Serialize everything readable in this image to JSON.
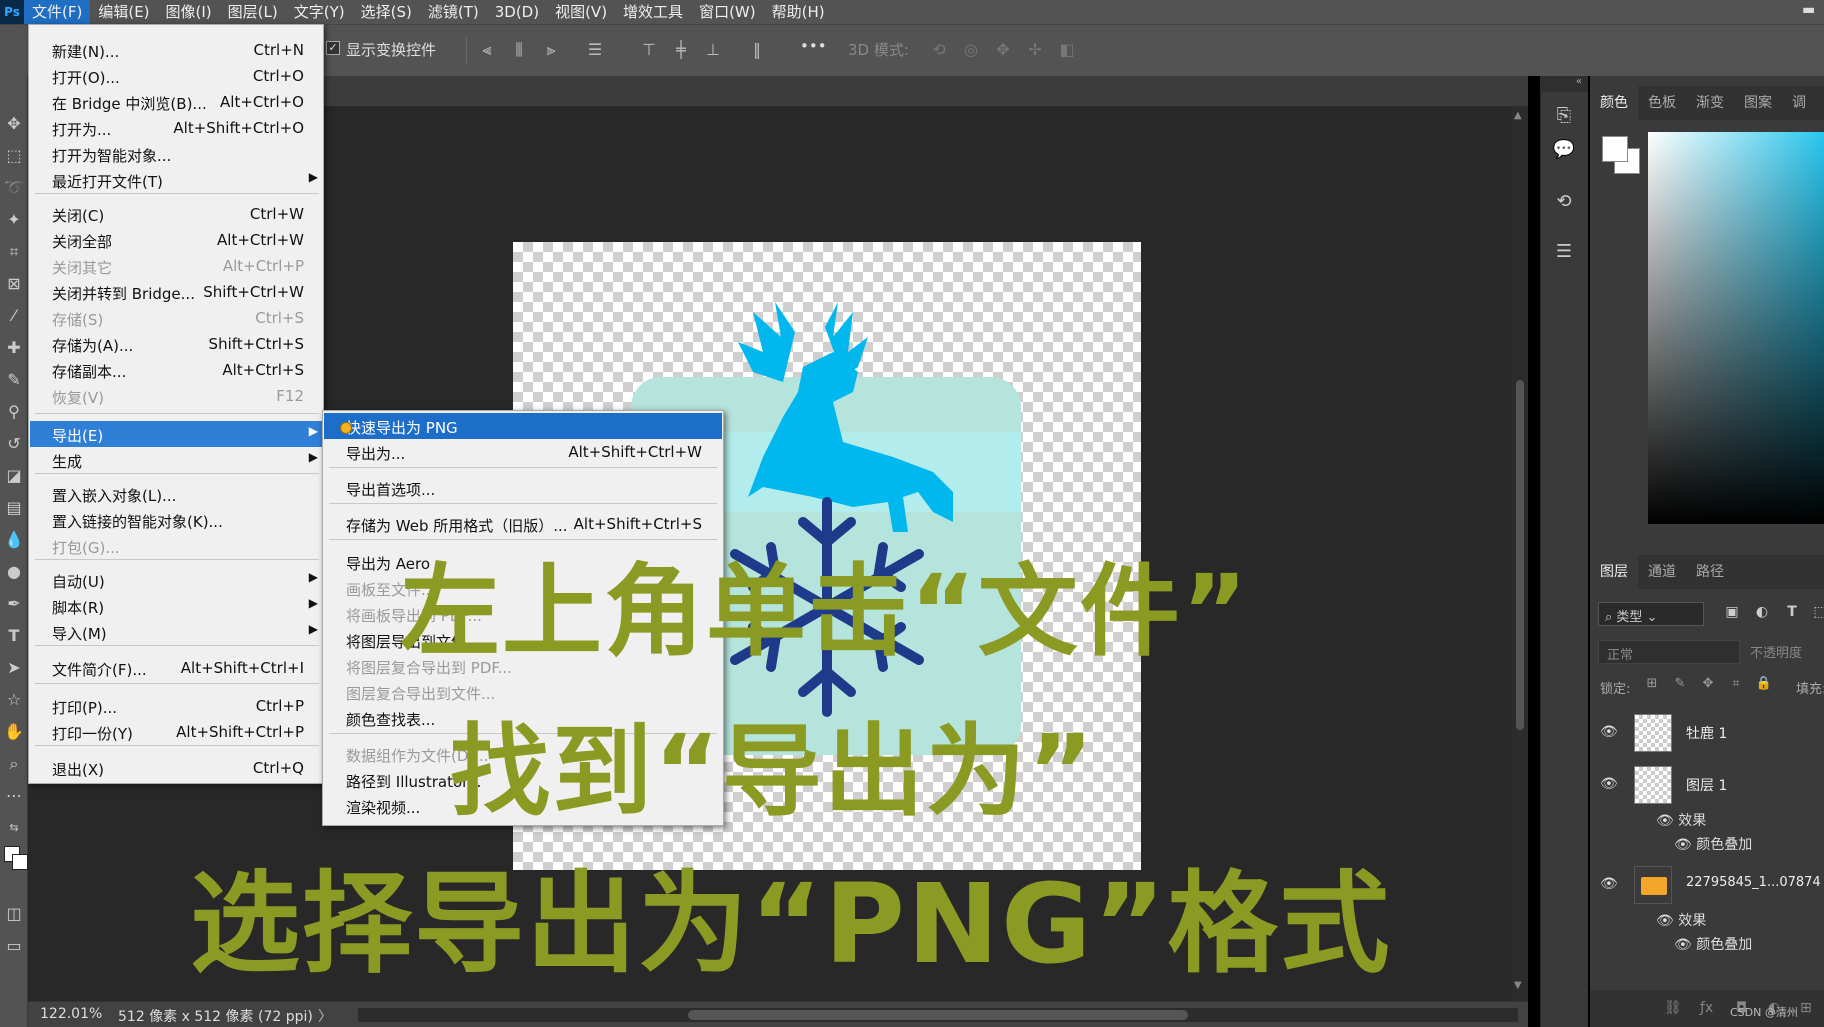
{
  "menubar": {
    "logo": "Ps",
    "items": [
      "文件(F)",
      "编辑(E)",
      "图像(I)",
      "图层(L)",
      "文字(Y)",
      "选择(S)",
      "滤镜(T)",
      "3D(D)",
      "视图(V)",
      "增效工具",
      "窗口(W)",
      "帮助(H)"
    ],
    "minimize": "▬"
  },
  "options": {
    "show_transform": "显示变换控件",
    "more": "•••",
    "mode3d": "3D 模式:"
  },
  "file_menu": {
    "items": [
      {
        "label": "新建(N)...",
        "shortcut": "Ctrl+N"
      },
      {
        "label": "打开(O)...",
        "shortcut": "Ctrl+O"
      },
      {
        "label": "在 Bridge 中浏览(B)...",
        "shortcut": "Alt+Ctrl+O"
      },
      {
        "label": "打开为...",
        "shortcut": "Alt+Shift+Ctrl+O"
      },
      {
        "label": "打开为智能对象...",
        "shortcut": ""
      },
      {
        "label": "最近打开文件(T)",
        "shortcut": ""
      },
      {
        "label": "关闭(C)",
        "shortcut": "Ctrl+W"
      },
      {
        "label": "关闭全部",
        "shortcut": "Alt+Ctrl+W"
      },
      {
        "label": "关闭其它",
        "shortcut": "Alt+Ctrl+P"
      },
      {
        "label": "关闭并转到 Bridge...",
        "shortcut": "Shift+Ctrl+W"
      },
      {
        "label": "存储(S)",
        "shortcut": "Ctrl+S"
      },
      {
        "label": "存储为(A)...",
        "shortcut": "Shift+Ctrl+S"
      },
      {
        "label": "存储副本...",
        "shortcut": "Alt+Ctrl+S"
      },
      {
        "label": "恢复(V)",
        "shortcut": "F12"
      },
      {
        "label": "导出(E)",
        "shortcut": ""
      },
      {
        "label": "生成",
        "shortcut": ""
      },
      {
        "label": "置入嵌入对象(L)...",
        "shortcut": ""
      },
      {
        "label": "置入链接的智能对象(K)...",
        "shortcut": ""
      },
      {
        "label": "打包(G)...",
        "shortcut": ""
      },
      {
        "label": "自动(U)",
        "shortcut": ""
      },
      {
        "label": "脚本(R)",
        "shortcut": ""
      },
      {
        "label": "导入(M)",
        "shortcut": ""
      },
      {
        "label": "文件简介(F)...",
        "shortcut": "Alt+Shift+Ctrl+I"
      },
      {
        "label": "打印(P)...",
        "shortcut": "Ctrl+P"
      },
      {
        "label": "打印一份(Y)",
        "shortcut": "Alt+Shift+Ctrl+P"
      },
      {
        "label": "退出(X)",
        "shortcut": "Ctrl+Q"
      }
    ],
    "arrow": "▶"
  },
  "export_menu": {
    "items": [
      {
        "label": "快速导出为 PNG",
        "shortcut": ""
      },
      {
        "label": "导出为...",
        "shortcut": "Alt+Shift+Ctrl+W"
      },
      {
        "label": "导出首选项...",
        "shortcut": ""
      },
      {
        "label": "存储为 Web 所用格式（旧版）...",
        "shortcut": "Alt+Shift+Ctrl+S"
      },
      {
        "label": "导出为 Aero",
        "shortcut": ""
      },
      {
        "label": "画板至文件...",
        "shortcut": ""
      },
      {
        "label": "将画板导出到 PDF...",
        "shortcut": ""
      },
      {
        "label": "将图层导出到文件...",
        "shortcut": ""
      },
      {
        "label": "将图层复合导出到 PDF...",
        "shortcut": ""
      },
      {
        "label": "图层复合导出到文件...",
        "shortcut": ""
      },
      {
        "label": "颜色查找表...",
        "shortcut": ""
      },
      {
        "label": "数据组作为文件(D)...",
        "shortcut": ""
      },
      {
        "label": "路径到 Illustrator...",
        "shortcut": ""
      },
      {
        "label": "渲染视频...",
        "shortcut": ""
      }
    ]
  },
  "status": {
    "zoom": "122.01%",
    "docsize": "512 像素 x 512 像素 (72 ppi)",
    "arrow": "〉"
  },
  "color_panel": {
    "tabs": [
      "颜色",
      "色板",
      "渐变",
      "图案",
      "调"
    ]
  },
  "layers_panel": {
    "tabs": [
      "图层",
      "通道",
      "路径"
    ],
    "filter": "类型",
    "blend": "正常",
    "opacity": "不透明度",
    "lock": "锁定:",
    "fill": "填充:",
    "layers": [
      {
        "name": "牡鹿 1"
      },
      {
        "name": "图层 1"
      },
      {
        "name": "22795845_1...07874"
      }
    ],
    "fx_label": "效果",
    "color_overlay": "颜色叠加"
  },
  "watermark": "CSDN @清州",
  "captions": {
    "line1": "左上角单击“文件”",
    "line2": "找到“导出为”",
    "line3": "选择导出为“PNG”格式"
  },
  "colors": {
    "accent": "#2f7fd6",
    "caption": "#8a9a22",
    "deer": "#00b8ee",
    "snowflake": "#1f3a8a"
  }
}
